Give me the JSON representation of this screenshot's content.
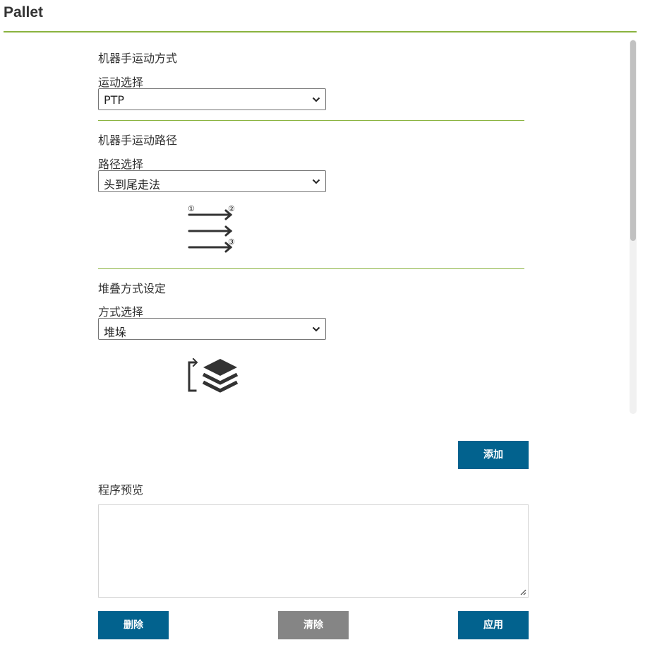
{
  "header": {
    "title": "Pallet"
  },
  "motion_mode": {
    "section_title": "机器手运动方式",
    "label": "运动选择",
    "selected": "PTP"
  },
  "motion_path": {
    "section_title": "机器手运动路径",
    "label": "路径选择",
    "selected": "头到尾走法",
    "diagram_markers": [
      "①",
      "②",
      "③"
    ]
  },
  "stacking": {
    "section_title": "堆叠方式设定",
    "label": "方式选择",
    "selected": "堆垛"
  },
  "actions": {
    "add_label": "添加",
    "delete_label": "删除",
    "clear_label": "清除",
    "apply_label": "应用"
  },
  "preview": {
    "title": "程序预览",
    "value": ""
  },
  "colors": {
    "accent_green": "#8ab33f",
    "button_blue": "#02628e",
    "button_gray": "#858585"
  }
}
